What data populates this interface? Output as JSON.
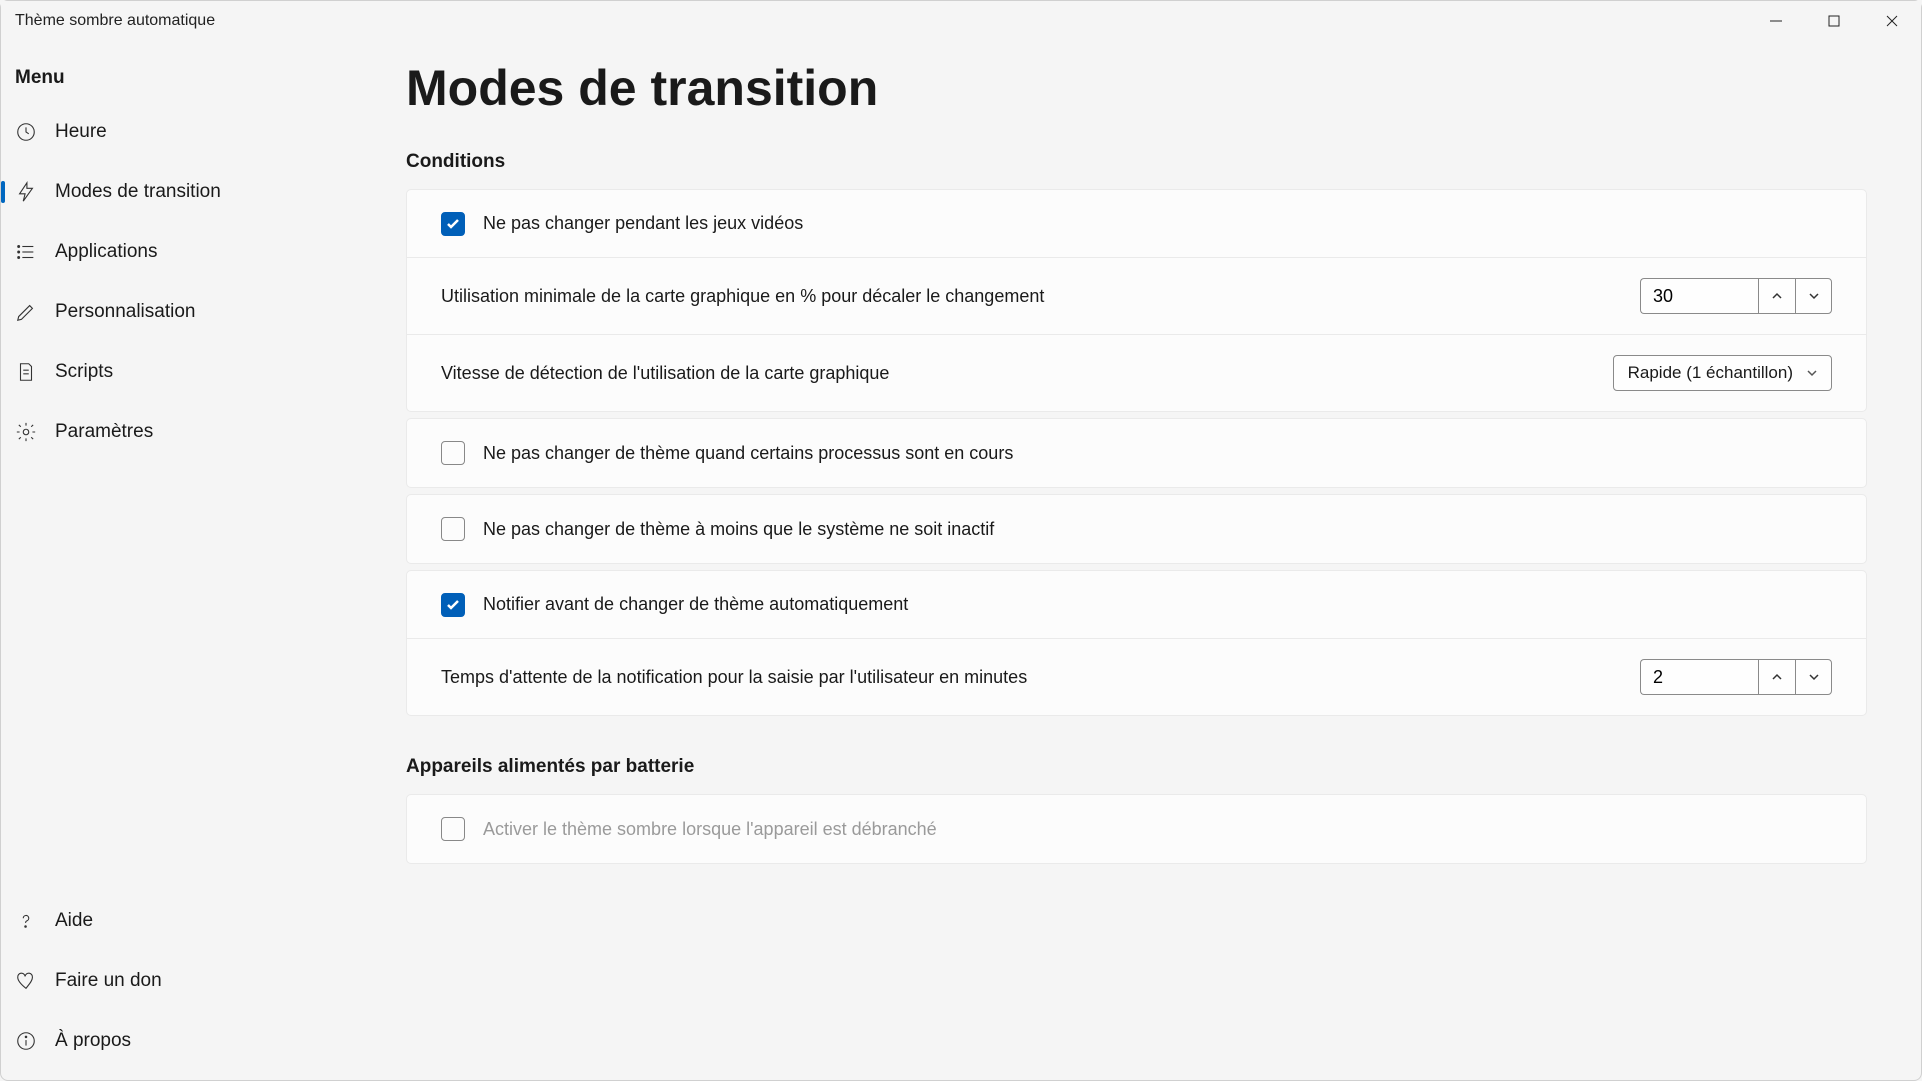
{
  "window": {
    "title": "Thème sombre automatique"
  },
  "sidebar": {
    "menu_label": "Menu",
    "items": [
      {
        "label": "Heure"
      },
      {
        "label": "Modes de transition"
      },
      {
        "label": "Applications"
      },
      {
        "label": "Personnalisation"
      },
      {
        "label": "Scripts"
      },
      {
        "label": "Paramètres"
      }
    ],
    "footer": [
      {
        "label": "Aide"
      },
      {
        "label": "Faire un don"
      },
      {
        "label": "À propos"
      }
    ]
  },
  "page": {
    "title": "Modes de transition",
    "sections": {
      "conditions": {
        "title": "Conditions",
        "games_checkbox_label": "Ne pas changer pendant les jeux vidéos",
        "gpu_percent_label": "Utilisation minimale de la carte graphique en % pour décaler le changement",
        "gpu_percent_value": "30",
        "gpu_speed_label": "Vitesse de détection de l'utilisation de la carte graphique",
        "gpu_speed_value": "Rapide (1 échantillon)",
        "process_checkbox_label": "Ne pas changer de thème quand certains processus sont en cours",
        "idle_checkbox_label": "Ne pas changer de thème à moins que le système ne soit inactif",
        "notify_checkbox_label": "Notifier avant de changer de thème automatiquement",
        "notify_wait_label": "Temps d'attente de la notification pour la saisie par l'utilisateur en minutes",
        "notify_wait_value": "2"
      },
      "battery": {
        "title": "Appareils alimentés par batterie",
        "enable_dark_unplugged_label": "Activer le thème sombre lorsque l'appareil est débranché"
      }
    }
  }
}
